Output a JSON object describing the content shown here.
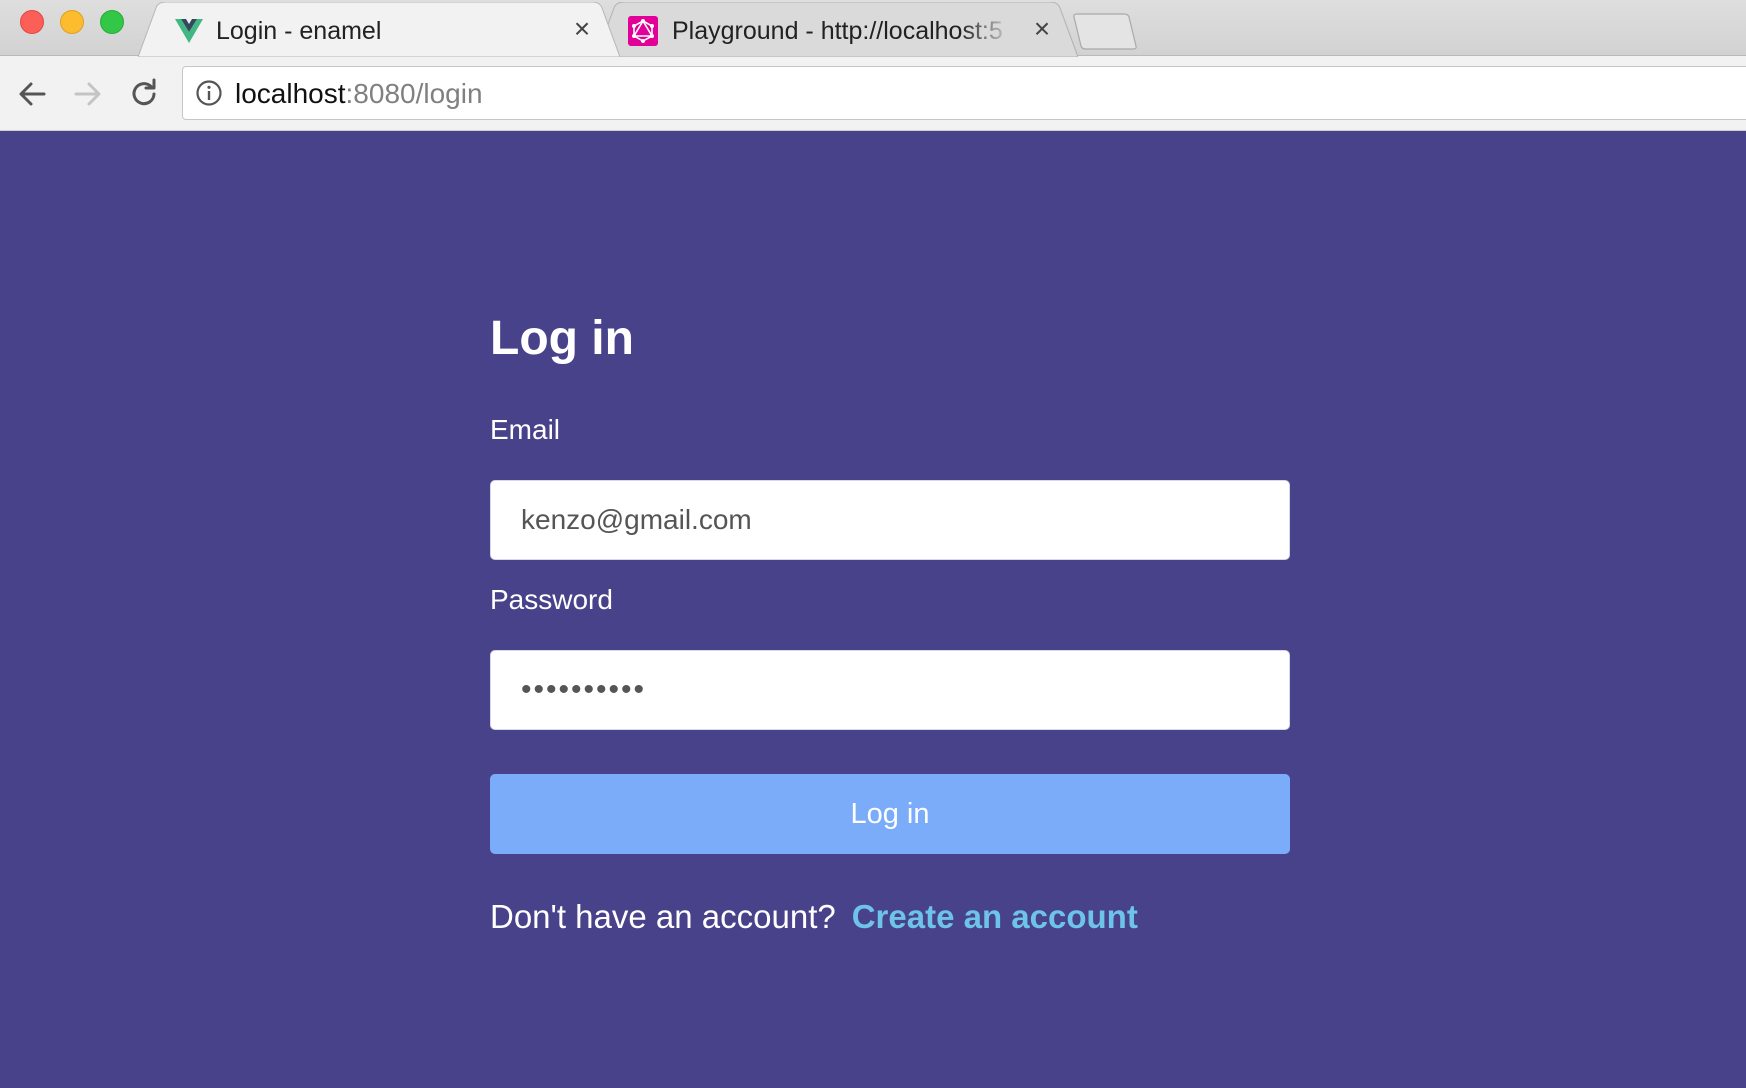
{
  "browser": {
    "tabs": [
      {
        "title": "Login - enamel",
        "favicon": "vue-logo-icon",
        "active": true
      },
      {
        "title": "Playground - http://localhost:5",
        "favicon": "graphql-logo-icon",
        "active": false
      }
    ],
    "url": {
      "host": "localhost",
      "path": ":8080/login"
    }
  },
  "login": {
    "title": "Log in",
    "email_label": "Email",
    "email_value": "kenzo@gmail.com",
    "password_label": "Password",
    "password_value": "••••••••••",
    "submit_label": "Log in",
    "signup_prompt": "Don't have an account?",
    "signup_link": "Create an account"
  },
  "colors": {
    "page_background": "#48428a",
    "button_background": "#7bacf9",
    "link": "#6ec3e8"
  }
}
